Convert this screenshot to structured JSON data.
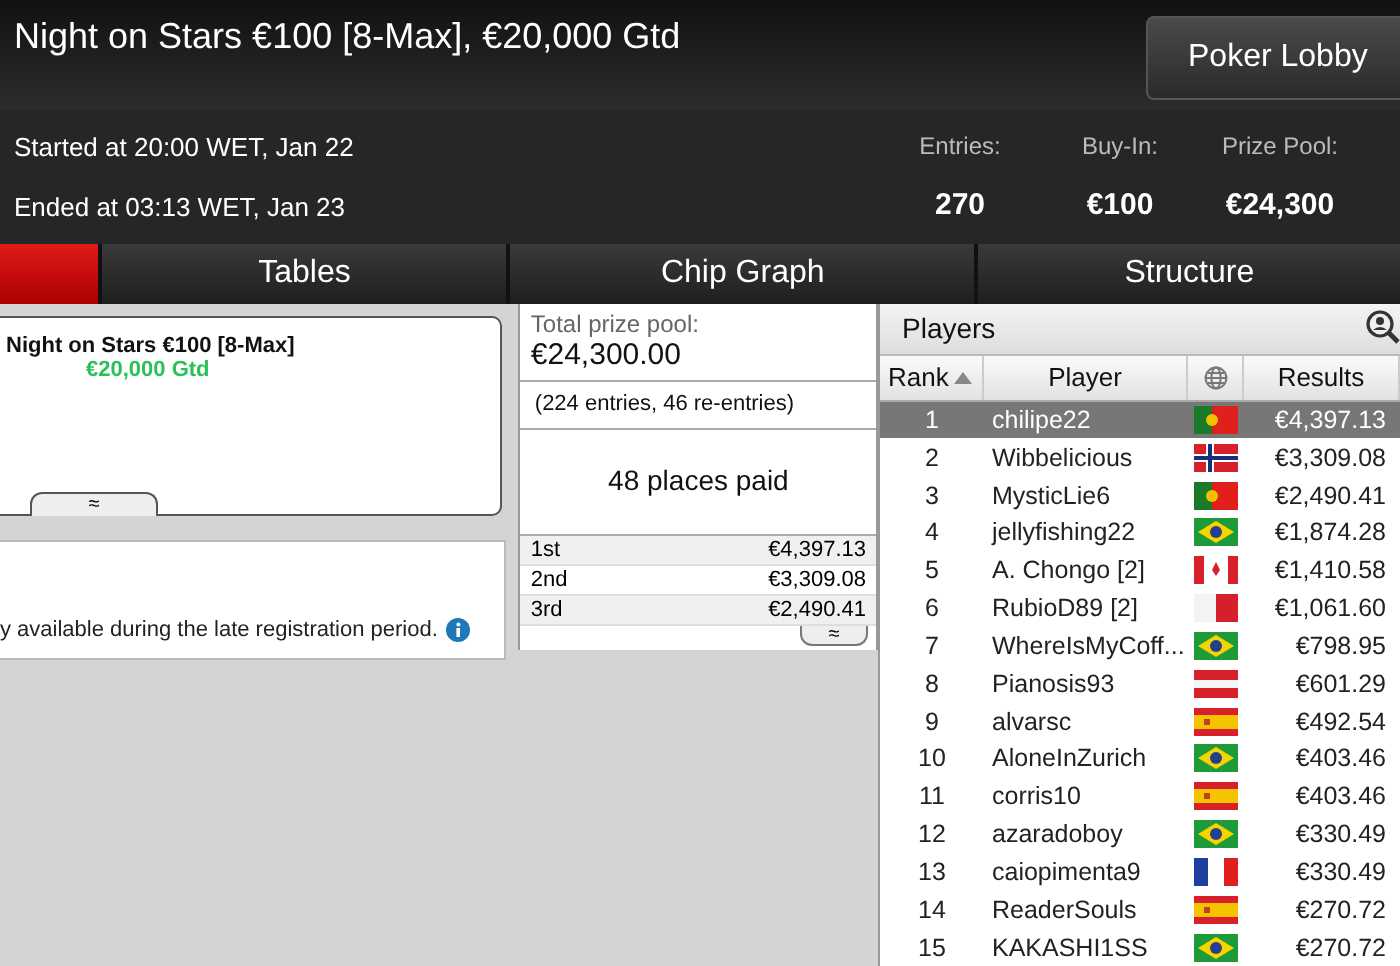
{
  "window": {
    "title": "Night on Stars €100 [8-Max], €20,000 Gtd",
    "lobby_button": "Poker Lobby"
  },
  "info": {
    "started": "Started at 20:00 WET, Jan 22",
    "ended": "Ended at 03:13 WET, Jan 23",
    "stats": [
      {
        "label": "Entries:",
        "value": "270"
      },
      {
        "label": "Buy-In:",
        "value": "€100"
      },
      {
        "label": "Prize Pool:",
        "value": "€24,300"
      }
    ]
  },
  "tabs": [
    {
      "selected": true
    },
    {
      "label": "Tables",
      "selected": false
    },
    {
      "label": "Chip Graph",
      "selected": false
    },
    {
      "label": "Structure",
      "selected": false
    }
  ],
  "summary": {
    "name": "Night on Stars €100 [8-Max]",
    "guarantee": "€20,000 Gtd",
    "collapse": "≈",
    "note": "y available during the late registration period."
  },
  "prizes": {
    "total_label": "Total prize pool:",
    "total": "€24,300.00",
    "entries": "(224 entries, 46 re-entries)",
    "places_paid": "48 places paid",
    "expand": "≈",
    "rows": [
      {
        "place": "1st",
        "amount": "€4,397.13"
      },
      {
        "place": "2nd",
        "amount": "€3,309.08"
      },
      {
        "place": "3rd",
        "amount": "€2,490.41"
      }
    ]
  },
  "players": {
    "title": "Players",
    "columns": [
      "Rank",
      "Player",
      "Results"
    ],
    "rows": [
      {
        "rank": "1",
        "name": "chilipe22",
        "kind": "pt",
        "result": "€4,397.13",
        "selected": true
      },
      {
        "rank": "2",
        "name": "Wibbelicious",
        "kind": "no",
        "result": "€3,309.08",
        "selected": false
      },
      {
        "rank": "3",
        "name": "MysticLie6",
        "kind": "pt",
        "result": "€2,490.41",
        "selected": false
      },
      {
        "rank": "4",
        "name": "jellyfishing22",
        "kind": "br",
        "result": "€1,874.28",
        "selected": false
      },
      {
        "rank": "5",
        "name": "A. Chongo [2]",
        "kind": "ca",
        "result": "€1,410.58",
        "selected": false
      },
      {
        "rank": "6",
        "name": "RubioD89 [2]",
        "kind": "mt",
        "result": "€1,061.60",
        "selected": false
      },
      {
        "rank": "7",
        "name": "WhereIsMyCoff...",
        "kind": "br",
        "result": "€798.95",
        "selected": false
      },
      {
        "rank": "8",
        "name": "Pianosis93",
        "kind": "at",
        "result": "€601.29",
        "selected": false
      },
      {
        "rank": "9",
        "name": "alvarsc",
        "kind": "es",
        "result": "€492.54",
        "selected": false
      },
      {
        "rank": "10",
        "name": "AloneInZurich",
        "kind": "br",
        "result": "€403.46",
        "selected": false
      },
      {
        "rank": "11",
        "name": "corris10",
        "kind": "es",
        "result": "€403.46",
        "selected": false
      },
      {
        "rank": "12",
        "name": "azaradoboy",
        "kind": "br",
        "result": "€330.49",
        "selected": false
      },
      {
        "rank": "13",
        "name": "caiopimenta9",
        "kind": "fr",
        "result": "€330.49",
        "selected": false
      },
      {
        "rank": "14",
        "name": "ReaderSouls",
        "kind": "es",
        "result": "€270.72",
        "selected": false
      },
      {
        "rank": "15",
        "name": "KAKASHI1SS",
        "kind": "br",
        "result": "€270.72",
        "selected": false
      }
    ]
  }
}
